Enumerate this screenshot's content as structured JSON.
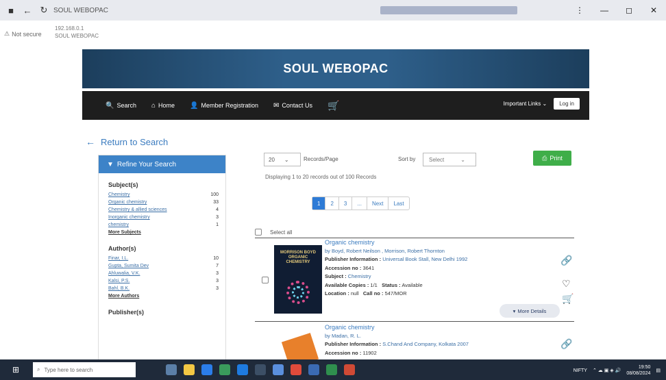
{
  "browser": {
    "tab_title": "SOUL WEBOPAC",
    "not_secure": "Not secure",
    "url_line1": "192.168.0.1",
    "url_line2": "SOUL WEBOPAC",
    "minimize": "—",
    "restore": "◻",
    "close": "✕",
    "menu": "⋮"
  },
  "site": {
    "title": "SOUL WEBOPAC",
    "nav": [
      {
        "icon": "🔍",
        "label": "Search"
      },
      {
        "icon": "⌂",
        "label": "Home"
      },
      {
        "icon": "👤",
        "label": "Member Registration"
      },
      {
        "icon": "✉",
        "label": "Contact Us"
      }
    ],
    "important_links": "Important Links ⌄",
    "login": "Log in"
  },
  "return_label": "Return to Search",
  "refine": {
    "header": "Refine Your Search",
    "subjects_title": "Subject(s)",
    "subjects": [
      {
        "label": "Chemistry",
        "count": "100"
      },
      {
        "label": "Organic chemistry",
        "count": "33"
      },
      {
        "label": "Chemistry & allied sciences",
        "count": "4"
      },
      {
        "label": "Inorganic chemistry",
        "count": "3"
      },
      {
        "label": "chemistry",
        "count": "1"
      }
    ],
    "subjects_more": "More Subjects",
    "authors_title": "Author(s)",
    "authors": [
      {
        "label": "Finar, I.L.",
        "count": "10"
      },
      {
        "label": "Gupta, Sumita Dev",
        "count": "7"
      },
      {
        "label": "Ahluwalia, V.K.",
        "count": "3"
      },
      {
        "label": "Kalsi, P.S.",
        "count": "3"
      },
      {
        "label": "Bahl, B.K.",
        "count": "3"
      }
    ],
    "authors_more": "More Authors",
    "publishers_title": "Publisher(s)"
  },
  "results": {
    "per_page_value": "20",
    "per_page_label": "Records/Page",
    "sort_label": "Sort by",
    "sort_value": "Select",
    "print_label": "Print",
    "displaying": "Displaying 1 to 20 records out of 100 Records",
    "pages": [
      "1",
      "2",
      "3",
      "...",
      "Next",
      "Last"
    ],
    "active_page": "1",
    "select_all": "Select all"
  },
  "records": [
    {
      "title": "Organic chemistry",
      "author": "by Boyd, Robert Neilson , Morrison, Robert Thornton",
      "publisher_key": "Publisher Information :",
      "publisher_val": "Universal Book Stall, New Delhi 1992",
      "accession_key": "Accession no :",
      "accession_val": "3641",
      "subject_key": "Subject :",
      "subject_val": "Chemistry",
      "copies_key": "Available Copies :",
      "copies_val": "1/1",
      "status_key": "Status :",
      "status_val": "Available",
      "location_key": "Location :",
      "location_val": "null",
      "callno_key": "Call no :",
      "callno_val": "547/MOR",
      "cover_text": "MORRISON BOYD ORGANIC CHEMISTRY",
      "more_details": "More Details"
    },
    {
      "title": "Organic chemistry",
      "author": "by Madan, R. L.",
      "publisher_key": "Publisher Information :",
      "publisher_val": "S.Chand And Company, Kolkata 2007",
      "accession_key": "Accession no :",
      "accession_val": "11902"
    }
  ],
  "taskbar": {
    "search_placeholder": "Type here to search",
    "tray_text": "NIFTY",
    "time": "19:50",
    "date": "08/08/2024"
  }
}
